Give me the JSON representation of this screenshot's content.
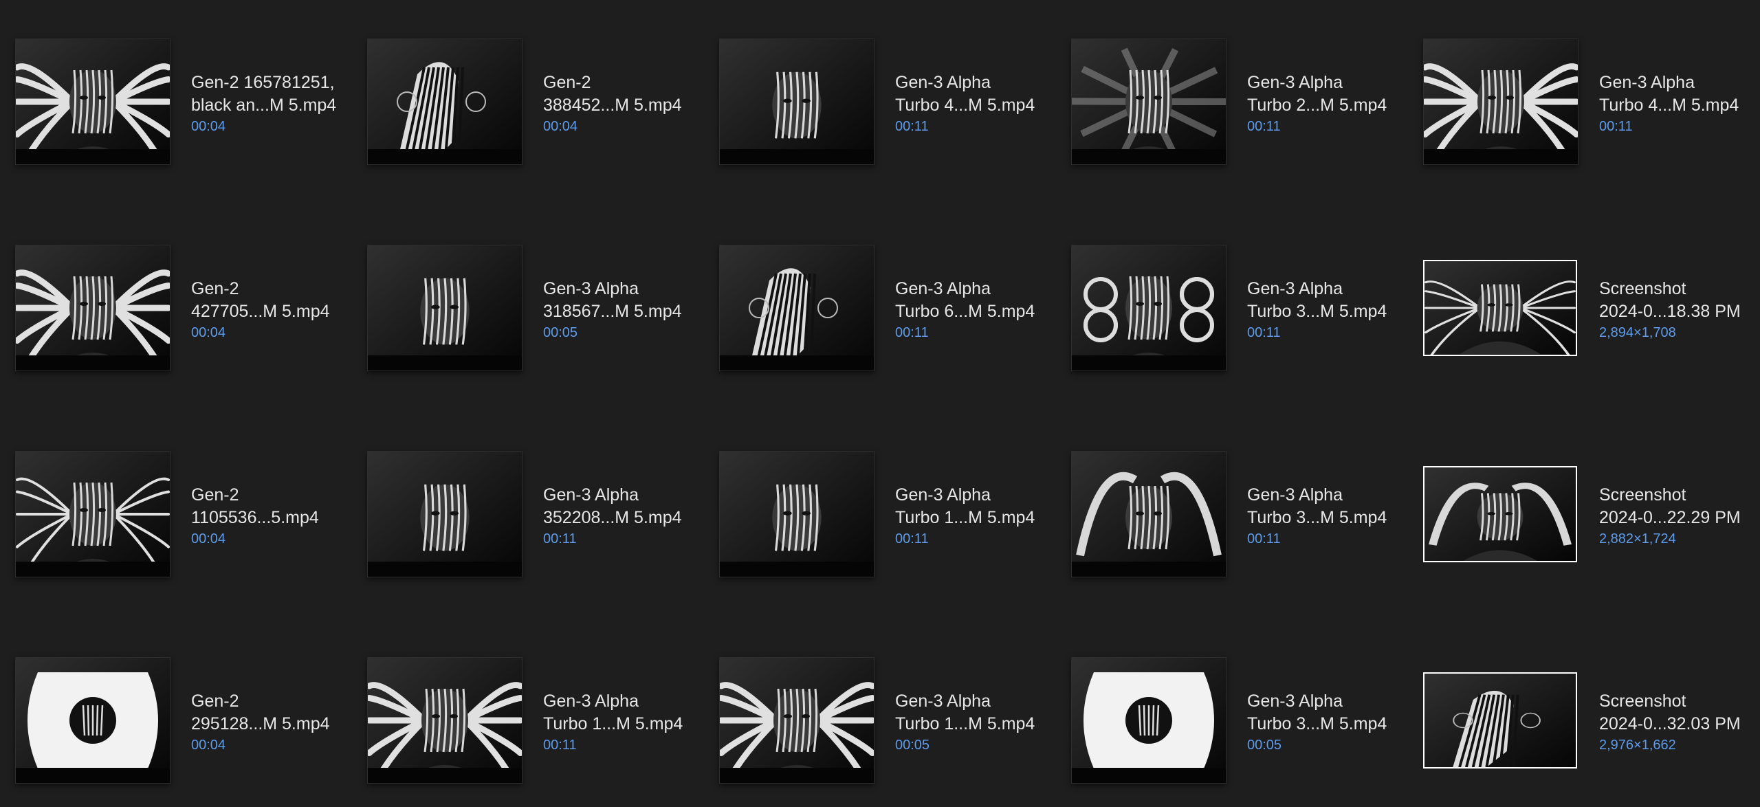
{
  "files": [
    {
      "line1": "Gen-2 165781251,",
      "line2": "black an...M 5.mp4",
      "info": "00:04",
      "kind": "video",
      "art": "antlers"
    },
    {
      "line1": "Gen-2",
      "line2": "388452...M 5.mp4",
      "info": "00:04",
      "kind": "video",
      "art": "zebra"
    },
    {
      "line1": "Gen-3 Alpha",
      "line2": "Turbo 4...M 5.mp4",
      "info": "00:11",
      "kind": "video",
      "art": "face"
    },
    {
      "line1": "Gen-3 Alpha",
      "line2": "Turbo 2...M 5.mp4",
      "info": "00:11",
      "kind": "video",
      "art": "blur"
    },
    {
      "line1": "Gen-3 Alpha",
      "line2": "Turbo 4...M 5.mp4",
      "info": "00:11",
      "kind": "video",
      "art": "antlers"
    },
    {
      "line1": "Gen-2",
      "line2": "427705...M 5.mp4",
      "info": "00:04",
      "kind": "video",
      "art": "antlers"
    },
    {
      "line1": "Gen-3 Alpha",
      "line2": "318567...M 5.mp4",
      "info": "00:05",
      "kind": "video",
      "art": "face"
    },
    {
      "line1": "Gen-3 Alpha",
      "line2": "Turbo 6...M 5.mp4",
      "info": "00:11",
      "kind": "video",
      "art": "zebra"
    },
    {
      "line1": "Gen-3 Alpha",
      "line2": "Turbo 3...M 5.mp4",
      "info": "00:11",
      "kind": "video",
      "art": "swirl"
    },
    {
      "line1": "Screenshot",
      "line2": "2024-0...18.38 PM",
      "info": "2,894×1,708",
      "kind": "image",
      "art": "spikes"
    },
    {
      "line1": "Gen-2",
      "line2": "1105536...5.mp4",
      "info": "00:04",
      "kind": "video",
      "art": "spikes"
    },
    {
      "line1": "Gen-3 Alpha",
      "line2": "352208...M 5.mp4",
      "info": "00:11",
      "kind": "video",
      "art": "face"
    },
    {
      "line1": "Gen-3 Alpha",
      "line2": "Turbo 1...M 5.mp4",
      "info": "00:11",
      "kind": "video",
      "art": "face"
    },
    {
      "line1": "Gen-3 Alpha",
      "line2": "Turbo 3...M 5.mp4",
      "info": "00:11",
      "kind": "video",
      "art": "hands"
    },
    {
      "line1": "Screenshot",
      "line2": "2024-0...22.29 PM",
      "info": "2,882×1,724",
      "kind": "image",
      "art": "hands"
    },
    {
      "line1": "Gen-2",
      "line2": "295128...M 5.mp4",
      "info": "00:04",
      "kind": "video",
      "art": "ring"
    },
    {
      "line1": "Gen-3 Alpha",
      "line2": "Turbo 1...M 5.mp4",
      "info": "00:11",
      "kind": "video",
      "art": "play"
    },
    {
      "line1": "Gen-3 Alpha",
      "line2": "Turbo 1...M 5.mp4",
      "info": "00:05",
      "kind": "video",
      "art": "antlers"
    },
    {
      "line1": "Gen-3 Alpha",
      "line2": "Turbo 3...M 5.mp4",
      "info": "00:05",
      "kind": "video",
      "art": "ring"
    },
    {
      "line1": "Screenshot",
      "line2": "2024-0...32.03 PM",
      "info": "2,976×1,662",
      "kind": "image",
      "art": "zebra"
    }
  ]
}
